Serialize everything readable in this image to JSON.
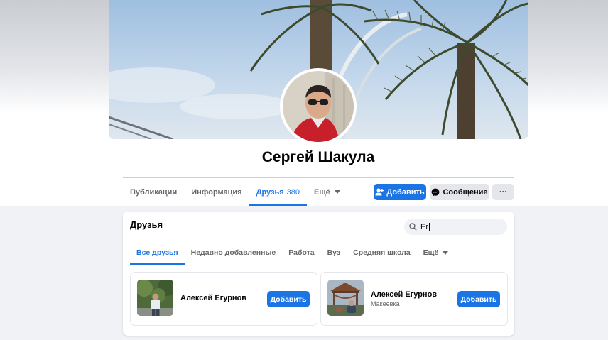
{
  "profile": {
    "name": "Сергей Шакула"
  },
  "nav": {
    "tabs": [
      {
        "label": "Публикации"
      },
      {
        "label": "Информация"
      },
      {
        "label": "Друзья",
        "count": "380"
      },
      {
        "label": "Ещё"
      }
    ],
    "active_tab": "Друзья"
  },
  "actions": {
    "add_label": "Добавить",
    "message_label": "Сообщение",
    "more_label": "···"
  },
  "friends_section": {
    "title": "Друзья",
    "search": {
      "value": "Ег"
    },
    "tabs": [
      {
        "label": "Все друзья"
      },
      {
        "label": "Недавно добавленные"
      },
      {
        "label": "Работа"
      },
      {
        "label": "Вуз"
      },
      {
        "label": "Средняя школа"
      },
      {
        "label": "Ещё"
      }
    ],
    "results": [
      {
        "name": "Алексей Егурнов",
        "subtitle": "",
        "button": "Добавить"
      },
      {
        "name": "Алексей Егурнов",
        "subtitle": "Макеевка",
        "button": "Добавить"
      }
    ]
  },
  "colors": {
    "accent": "#1b74e4",
    "secondary_button": "#e4e6eb",
    "page_background": "#f0f2f5"
  },
  "icons": [
    "add-friend-icon",
    "messenger-icon",
    "search-icon",
    "caret-down-icon"
  ]
}
